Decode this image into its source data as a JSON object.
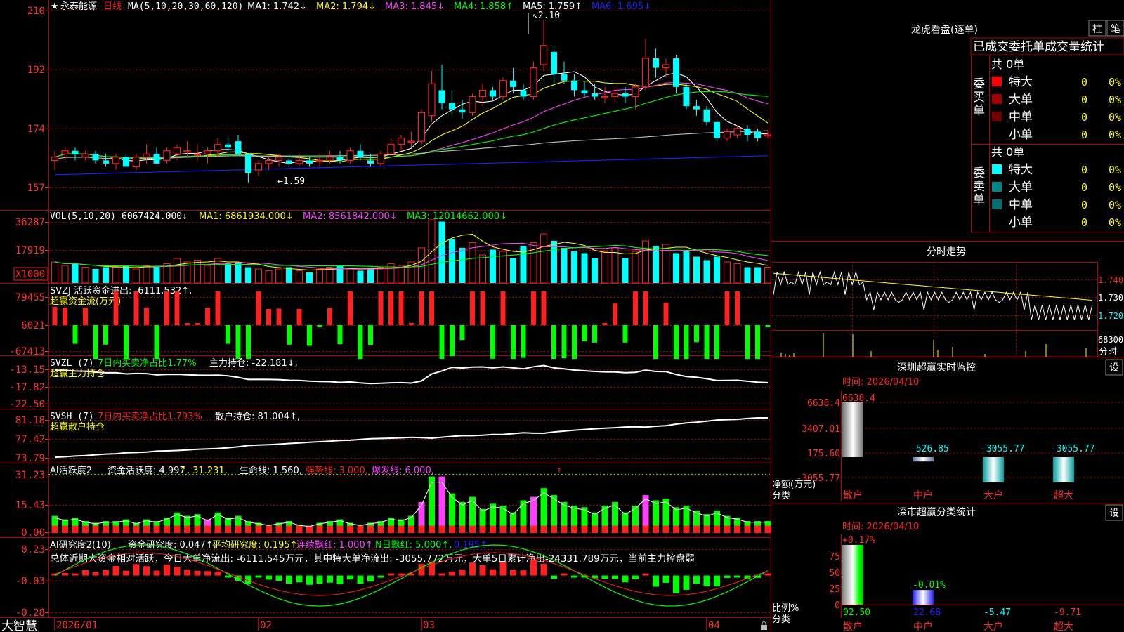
{
  "stock": {
    "star": "★",
    "name": "永泰能源",
    "period": "日线"
  },
  "colors": {
    "up": "#ff2020",
    "down": "#00ffff",
    "grid": "#b40000",
    "axis": "#ff3030",
    "white": "#ffffff",
    "yellow": "#ffff00",
    "magenta": "#ff40ff",
    "green": "#00ff00",
    "blue": "#2020ff",
    "gray": "#c0c0c0"
  },
  "ma_bar": {
    "head": "MA(5,10,20,30,60,120)",
    "items": [
      {
        "label": "MA1: 1.742↓",
        "color": "#ffffff"
      },
      {
        "label": "MA2: 1.794↓",
        "color": "#ffff00"
      },
      {
        "label": "MA3: 1.845↓",
        "color": "#ff40ff"
      },
      {
        "label": "MA4: 1.858↑",
        "color": "#00ff00"
      },
      {
        "label": "MA5: 1.759↑",
        "color": "#ffffff"
      },
      {
        "label": "MA6: 1.695↓",
        "color": "#2020ff"
      }
    ]
  },
  "kline_axis": {
    "ticks": [
      "210",
      "192",
      "174",
      "157"
    ],
    "range": [
      1.52,
      2.145
    ]
  },
  "annotations": {
    "high": "2.10",
    "low": "1.59"
  },
  "vol": {
    "head": "VOL(5,10,20)",
    "value": "6067424.000↓",
    "items": [
      {
        "label": "MA1: 6861934.000↓",
        "color": "#ffff00"
      },
      {
        "label": "MA2: 8561842.000↓",
        "color": "#ff40ff"
      },
      {
        "label": "MA3: 12014662.000↓",
        "color": "#00ff00"
      }
    ],
    "ticks": [
      "36287",
      "17919"
    ],
    "unit": "X1000",
    "max": 38000
  },
  "svzj": {
    "line1": "SVZJ  活跃资金进出: -6111.532↑,",
    "line2": "超赢资金流(万元)",
    "ticks": [
      "79455",
      "6021",
      "-67413"
    ],
    "range": [
      -80000,
      85000
    ]
  },
  "svzl": {
    "line1a": "SVZL (7)",
    "line1b": "7日内买卖净占比1.77%",
    "line1c": "主力持仓: -22.181↓,",
    "line2": "超赢主力持仓",
    "ticks": [
      "-13.15",
      "-17.82",
      "-22.50"
    ],
    "range": [
      -23,
      -12
    ]
  },
  "svsh": {
    "line1a": "SVSH (7)",
    "line1b": "7日内买卖净占比1.793%",
    "line1c": "散户持仓: 81.004↑,",
    "line2": "超赢散户持仓",
    "ticks": [
      "81.18",
      "77.42",
      "73.79"
    ],
    "range": [
      73.0,
      82.0
    ]
  },
  "ai_active": {
    "label": "AI活跃度2",
    "items": [
      {
        "label": "资金活跃度: 4.997",
        "color": "#ffffff"
      },
      {
        "label": "↑, 31.231,",
        "color": "#ffff00"
      },
      {
        "label": "生命线: 1.560,",
        "color": "#ffffff"
      },
      {
        "label": "强势线: 3.000,",
        "color": "#ff2020"
      },
      {
        "label": "爆发线: 6.000,",
        "color": "#ff40ff"
      }
    ],
    "arrow": "↑",
    "ticks": [
      "31.23",
      "15.43",
      "0.00"
    ],
    "max": 32
  },
  "ai_research": {
    "label": "AI研究度2(10)",
    "items": [
      {
        "label": "资金研究度: 0.047↑,",
        "color": "#ffffff"
      },
      {
        "label": "平均研究度: 0.195↑,",
        "color": "#ffff00"
      },
      {
        "label": "连续飘红: 1.000↑,",
        "color": "#ff40ff"
      },
      {
        "label": "N日飘红: 5.000↑,",
        "color": "#00ff00"
      },
      {
        "label": "0.195↑",
        "color": "#2020ff"
      }
    ],
    "summary": "总体近期大资金相对活跃，今日大单净流出: -6111.545万元，其中特大单净流出: -3055.772万元，大单5日累计净出-24331.789万元，当前主力控盘弱",
    "ticks": [
      "0.23",
      "-0.03",
      "-0.28"
    ],
    "range": [
      -0.3,
      0.25
    ]
  },
  "x_axis": {
    "labels": [
      "2026/01",
      "02",
      "03",
      "04"
    ]
  },
  "brand": "大智慧",
  "right": {
    "dragon_title": "龙虎看盘(逐单)",
    "btn_zhu": "柱",
    "btn_bi": "笔",
    "stats_title": "已成交委托单成交量统计",
    "buy_group": "委买单",
    "sell_group": "委卖单",
    "buy_total": "共 0单",
    "sell_total": "共 0单",
    "buy_rows": [
      {
        "label": "特大",
        "count": "0",
        "pct": "0%",
        "color": "#ff0000"
      },
      {
        "label": "大单",
        "count": "0",
        "pct": "0%",
        "color": "#a00000"
      },
      {
        "label": "中单",
        "count": "0",
        "pct": "0%",
        "color": "#700000"
      },
      {
        "label": "小单",
        "count": "0",
        "pct": "0%",
        "color": ""
      }
    ],
    "sell_rows": [
      {
        "label": "特大",
        "count": "0",
        "pct": "0%",
        "color": "#00ffff"
      },
      {
        "label": "大单",
        "count": "0",
        "pct": "0%",
        "color": "#008888"
      },
      {
        "label": "中单",
        "count": "0",
        "pct": "0%",
        "color": "#007070"
      },
      {
        "label": "小单",
        "count": "0",
        "pct": "0%",
        "color": ""
      }
    ],
    "intraday_title": "分时走势",
    "intraday_ticks": [
      "1.740",
      "1.730",
      "1.720"
    ],
    "intraday_vol_tick": "68300",
    "intraday_vol_label": "分时",
    "sz_title": "深圳超赢实时监控",
    "sz_set": "设",
    "sz_time": "时间: 2026/04/10",
    "sz_ticks": [
      "6638.4",
      "3407.01",
      "175.60",
      "-3055.77"
    ],
    "sz_axis_label1": "净额(万元)",
    "sz_axis_label2": "分类",
    "sz_bars": [
      {
        "cat": "散户",
        "label": "6638.4",
        "value": 6638.4
      },
      {
        "cat": "中户",
        "label": "-526.85",
        "value": -526.85
      },
      {
        "cat": "大户",
        "label": "-3055.77",
        "value": -3055.77
      },
      {
        "cat": "超大",
        "label": "-3055.77",
        "value": -3055.77
      }
    ],
    "cls_title": "深市超赢分类统计",
    "cls_set": "设",
    "cls_time": "时间: 2026/04/10",
    "cls_ticks": [
      "75",
      "50",
      "25",
      "0"
    ],
    "cls_axis_label1": "比例%",
    "cls_axis_label2": "分类",
    "cls_bars": [
      {
        "cat": "散户",
        "top": "+0.17%",
        "bottom": "92.50",
        "value": 92.5
      },
      {
        "cat": "中户",
        "top": "-0.01%",
        "bottom": "22.68",
        "value": 22.68
      },
      {
        "cat": "大户",
        "top": "",
        "bottom": "-5.47",
        "value": -5.47
      },
      {
        "cat": "超大",
        "top": "",
        "bottom": "-9.71",
        "value": -9.71
      }
    ]
  },
  "chart_data": {
    "type": "candlestick",
    "title": "永泰能源 日线",
    "candles": [
      {
        "o": 1.66,
        "h": 1.69,
        "l": 1.63,
        "c": 1.67
      },
      {
        "o": 1.68,
        "h": 1.7,
        "l": 1.66,
        "c": 1.69
      },
      {
        "o": 1.69,
        "h": 1.7,
        "l": 1.66,
        "c": 1.68
      },
      {
        "o": 1.67,
        "h": 1.69,
        "l": 1.66,
        "c": 1.68
      },
      {
        "o": 1.68,
        "h": 1.69,
        "l": 1.65,
        "c": 1.66
      },
      {
        "o": 1.66,
        "h": 1.68,
        "l": 1.64,
        "c": 1.65
      },
      {
        "o": 1.65,
        "h": 1.68,
        "l": 1.63,
        "c": 1.67
      },
      {
        "o": 1.67,
        "h": 1.68,
        "l": 1.64,
        "c": 1.64
      },
      {
        "o": 1.64,
        "h": 1.68,
        "l": 1.63,
        "c": 1.67
      },
      {
        "o": 1.67,
        "h": 1.71,
        "l": 1.65,
        "c": 1.68
      },
      {
        "o": 1.68,
        "h": 1.7,
        "l": 1.65,
        "c": 1.65
      },
      {
        "o": 1.66,
        "h": 1.7,
        "l": 1.65,
        "c": 1.69
      },
      {
        "o": 1.68,
        "h": 1.71,
        "l": 1.66,
        "c": 1.7
      },
      {
        "o": 1.69,
        "h": 1.72,
        "l": 1.67,
        "c": 1.69
      },
      {
        "o": 1.68,
        "h": 1.71,
        "l": 1.66,
        "c": 1.68
      },
      {
        "o": 1.68,
        "h": 1.7,
        "l": 1.65,
        "c": 1.69
      },
      {
        "o": 1.69,
        "h": 1.73,
        "l": 1.67,
        "c": 1.71
      },
      {
        "o": 1.71,
        "h": 1.73,
        "l": 1.68,
        "c": 1.7
      },
      {
        "o": 1.72,
        "h": 1.74,
        "l": 1.68,
        "c": 1.68
      },
      {
        "o": 1.68,
        "h": 1.68,
        "l": 1.59,
        "c": 1.62
      },
      {
        "o": 1.63,
        "h": 1.66,
        "l": 1.61,
        "c": 1.65
      },
      {
        "o": 1.65,
        "h": 1.67,
        "l": 1.63,
        "c": 1.66
      },
      {
        "o": 1.66,
        "h": 1.68,
        "l": 1.64,
        "c": 1.67
      },
      {
        "o": 1.66,
        "h": 1.68,
        "l": 1.64,
        "c": 1.65
      },
      {
        "o": 1.65,
        "h": 1.68,
        "l": 1.64,
        "c": 1.66
      },
      {
        "o": 1.66,
        "h": 1.67,
        "l": 1.64,
        "c": 1.65
      },
      {
        "o": 1.66,
        "h": 1.68,
        "l": 1.64,
        "c": 1.66
      },
      {
        "o": 1.66,
        "h": 1.69,
        "l": 1.65,
        "c": 1.67
      },
      {
        "o": 1.67,
        "h": 1.69,
        "l": 1.65,
        "c": 1.66
      },
      {
        "o": 1.66,
        "h": 1.7,
        "l": 1.65,
        "c": 1.69
      },
      {
        "o": 1.69,
        "h": 1.71,
        "l": 1.66,
        "c": 1.67
      },
      {
        "o": 1.66,
        "h": 1.68,
        "l": 1.64,
        "c": 1.65
      },
      {
        "o": 1.65,
        "h": 1.69,
        "l": 1.64,
        "c": 1.68
      },
      {
        "o": 1.68,
        "h": 1.73,
        "l": 1.67,
        "c": 1.71
      },
      {
        "o": 1.71,
        "h": 1.74,
        "l": 1.69,
        "c": 1.73
      },
      {
        "o": 1.72,
        "h": 1.75,
        "l": 1.7,
        "c": 1.72
      },
      {
        "o": 1.72,
        "h": 1.82,
        "l": 1.71,
        "c": 1.81
      },
      {
        "o": 1.8,
        "h": 1.94,
        "l": 1.78,
        "c": 1.9
      },
      {
        "o": 1.88,
        "h": 1.96,
        "l": 1.82,
        "c": 1.84
      },
      {
        "o": 1.84,
        "h": 1.88,
        "l": 1.8,
        "c": 1.82
      },
      {
        "o": 1.82,
        "h": 1.85,
        "l": 1.79,
        "c": 1.81
      },
      {
        "o": 1.81,
        "h": 1.87,
        "l": 1.8,
        "c": 1.86
      },
      {
        "o": 1.86,
        "h": 1.9,
        "l": 1.83,
        "c": 1.88
      },
      {
        "o": 1.88,
        "h": 1.89,
        "l": 1.85,
        "c": 1.86
      },
      {
        "o": 1.86,
        "h": 1.92,
        "l": 1.85,
        "c": 1.91
      },
      {
        "o": 1.91,
        "h": 1.95,
        "l": 1.87,
        "c": 1.89
      },
      {
        "o": 1.88,
        "h": 1.9,
        "l": 1.85,
        "c": 1.86
      },
      {
        "o": 1.86,
        "h": 1.97,
        "l": 1.85,
        "c": 1.95
      },
      {
        "o": 1.96,
        "h": 2.1,
        "l": 1.94,
        "c": 2.02
      },
      {
        "o": 2.0,
        "h": 2.02,
        "l": 1.9,
        "c": 1.93
      },
      {
        "o": 1.93,
        "h": 1.97,
        "l": 1.9,
        "c": 1.91
      },
      {
        "o": 1.91,
        "h": 1.93,
        "l": 1.86,
        "c": 1.88
      },
      {
        "o": 1.88,
        "h": 1.91,
        "l": 1.86,
        "c": 1.87
      },
      {
        "o": 1.87,
        "h": 1.9,
        "l": 1.85,
        "c": 1.86
      },
      {
        "o": 1.86,
        "h": 1.89,
        "l": 1.84,
        "c": 1.86
      },
      {
        "o": 1.86,
        "h": 1.89,
        "l": 1.84,
        "c": 1.87
      },
      {
        "o": 1.87,
        "h": 1.89,
        "l": 1.84,
        "c": 1.86
      },
      {
        "o": 1.86,
        "h": 1.9,
        "l": 1.82,
        "c": 1.89
      },
      {
        "o": 1.89,
        "h": 2.04,
        "l": 1.88,
        "c": 1.98
      },
      {
        "o": 1.98,
        "h": 2.01,
        "l": 1.92,
        "c": 1.95
      },
      {
        "o": 1.95,
        "h": 1.98,
        "l": 1.92,
        "c": 1.96
      },
      {
        "o": 1.98,
        "h": 1.99,
        "l": 1.87,
        "c": 1.89
      },
      {
        "o": 1.89,
        "h": 1.9,
        "l": 1.82,
        "c": 1.83
      },
      {
        "o": 1.83,
        "h": 1.85,
        "l": 1.8,
        "c": 1.82
      },
      {
        "o": 1.82,
        "h": 1.83,
        "l": 1.77,
        "c": 1.78
      },
      {
        "o": 1.78,
        "h": 1.79,
        "l": 1.72,
        "c": 1.73
      },
      {
        "o": 1.73,
        "h": 1.76,
        "l": 1.72,
        "c": 1.75
      },
      {
        "o": 1.74,
        "h": 1.77,
        "l": 1.73,
        "c": 1.76
      },
      {
        "o": 1.76,
        "h": 1.77,
        "l": 1.72,
        "c": 1.74
      },
      {
        "o": 1.75,
        "h": 1.76,
        "l": 1.72,
        "c": 1.73
      },
      {
        "o": 1.74,
        "h": 1.75,
        "l": 1.73,
        "c": 1.74
      }
    ],
    "volume": [
      12,
      10,
      11,
      9,
      8,
      9,
      9,
      10,
      8,
      10,
      9,
      11,
      14,
      12,
      13,
      10,
      14,
      11,
      12,
      9,
      8,
      7,
      8,
      9,
      7,
      6,
      8,
      9,
      10,
      8,
      7,
      8,
      9,
      11,
      10,
      12,
      20,
      36,
      35,
      25,
      20,
      23,
      16,
      19,
      18,
      14,
      21,
      23,
      28,
      24,
      20,
      18,
      17,
      14,
      18,
      20,
      14,
      18,
      24,
      21,
      22,
      17,
      18,
      15,
      13,
      15,
      12,
      11,
      9,
      9,
      9
    ]
  }
}
